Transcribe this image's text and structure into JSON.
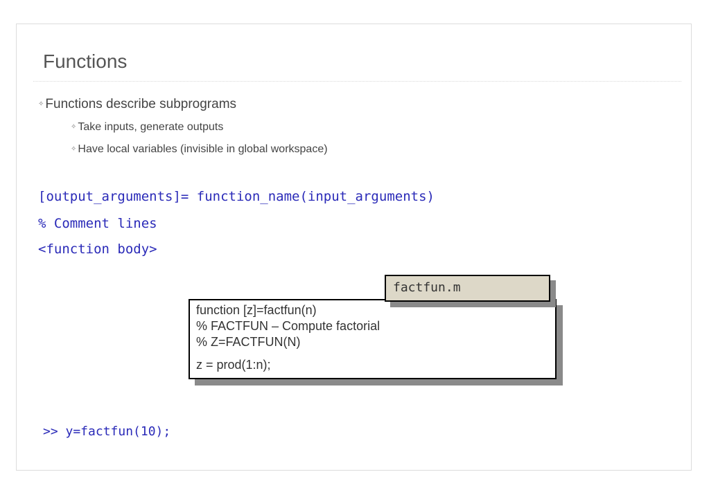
{
  "slide": {
    "title": "Functions",
    "bullets": [
      {
        "level": 1,
        "text": "Functions describe subprograms"
      },
      {
        "level": 2,
        "text": "Take inputs, generate outputs"
      },
      {
        "level": 2,
        "text": "Have local variables (invisible in global workspace)"
      }
    ],
    "bullet_marker": "✧",
    "syntax": {
      "line1": "[output_arguments]= function_name(input_arguments)",
      "line2": "% Comment lines",
      "line3": "<function body>"
    },
    "file_label": "factfun.m",
    "file_code": {
      "line1": "function [z]=factfun(n)",
      "line2": "% FACTFUN – Compute factorial",
      "line3": "% Z=FACTFUN(N)",
      "line4": "z = prod(1:n);"
    },
    "command": ">> y=factfun(10);"
  },
  "colors": {
    "code_blue": "#2a2ab8",
    "text_gray": "#444444",
    "file_tab_bg": "#ddd8c8",
    "shadow": "#8a8a8a"
  }
}
